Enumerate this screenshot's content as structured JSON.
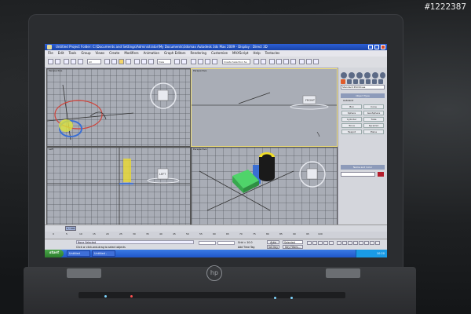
{
  "watermark": "#1222387",
  "app": {
    "title": "Untitled    Project Folder: C:\\Documents and Settings\\Administrator\\My Documents\\3dsmax        Autodesk 3ds Max 2009        - Display : Direct 3D",
    "menu": [
      "File",
      "Edit",
      "Tools",
      "Group",
      "Views",
      "Create",
      "Modifiers",
      "Animation",
      "Graph Editors",
      "Rendering",
      "Customize",
      "MAXScript",
      "Help",
      "Tentacles"
    ],
    "toolbar": {
      "selection_filter": "All",
      "view_dropdown": "View",
      "named_selection": "Create Selection Se"
    }
  },
  "viewports": [
    {
      "label": "Perspective",
      "active": false
    },
    {
      "label": "Perspective",
      "active": true
    },
    {
      "label": "Left",
      "active": false
    },
    {
      "label": "Perspective",
      "active": false
    }
  ],
  "viewcube": {
    "vp1": "",
    "vp2": "FRONT",
    "vp3": "LEFT",
    "vp4": ""
  },
  "command_panel": {
    "category": "Standard Primitives",
    "section_object_type": "Object Type",
    "autogrid": "AutoGrid",
    "buttons": [
      "Box",
      "Cone",
      "Sphere",
      "GeoSphere",
      "Cylinder",
      "Tube",
      "Torus",
      "Pyramid",
      "Teapot",
      "Plane"
    ],
    "section_name_color": "Name and Color"
  },
  "timeline": {
    "frame_readout": "0 / 100",
    "ticks": [
      "0",
      "5",
      "10",
      "15",
      "20",
      "25",
      "30",
      "35",
      "40",
      "45",
      "50",
      "55",
      "60",
      "65",
      "70",
      "75",
      "80",
      "85",
      "90",
      "95",
      "100"
    ]
  },
  "status": {
    "selected": "None Selected",
    "prompt": "Click or click-and-drag to select objects",
    "grid": "Grid = 10.0",
    "autokey": "Auto Key",
    "selected_dropdown": "Selected",
    "setkey": "Set Key",
    "keyfilters": "Key Filters...",
    "add_time_tag": "Add Time Tag"
  },
  "taskbar": {
    "start": "start",
    "tasks": [
      "Untitled",
      "Untitled - Direct3D"
    ],
    "clock": "10:20"
  },
  "colors": {
    "viewport_bg": "#a9adb6",
    "active_border": "#f3e27a",
    "box_green": "#4fd46a",
    "cylinder_yellow": "#f0dd27",
    "name_color_swatch": "#b41e2c"
  }
}
